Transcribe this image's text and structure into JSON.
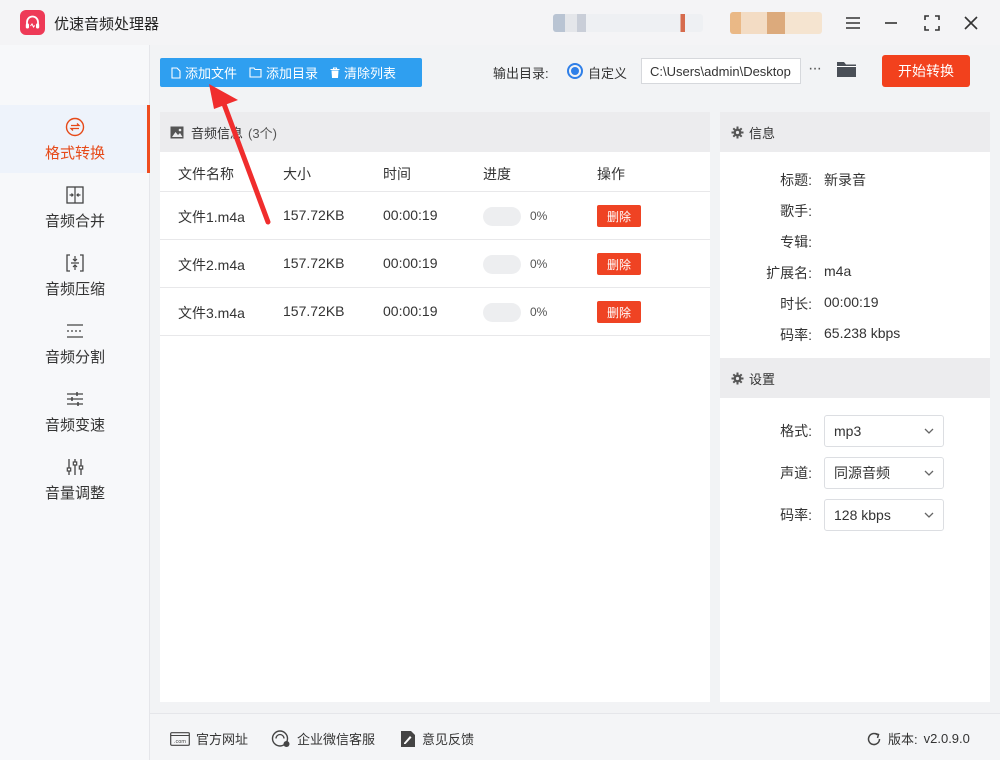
{
  "app": {
    "title": "优速音频处理器"
  },
  "sidebar": {
    "items": [
      {
        "label": "格式转换",
        "icon": "format-convert-icon",
        "active": true
      },
      {
        "label": "音频合并",
        "icon": "merge-icon",
        "active": false
      },
      {
        "label": "音频压缩",
        "icon": "compress-icon",
        "active": false
      },
      {
        "label": "音频分割",
        "icon": "split-icon",
        "active": false
      },
      {
        "label": "音频变速",
        "icon": "speed-icon",
        "active": false
      },
      {
        "label": "音量调整",
        "icon": "volume-icon",
        "active": false
      }
    ]
  },
  "toolbar": {
    "add_file": "添加文件",
    "add_dir": "添加目录",
    "clear_list": "清除列表",
    "output_label": "输出目录:",
    "output_option": "自定义",
    "output_path": "C:\\Users\\admin\\Desktop",
    "more": "···",
    "start": "开始转换"
  },
  "file_panel": {
    "title": "音频信息",
    "count": "(3个)",
    "columns": [
      "文件名称",
      "大小",
      "时间",
      "进度",
      "操作"
    ],
    "rows": [
      {
        "name": "文件1.m4a",
        "size": "157.72KB",
        "time": "00:00:19",
        "progress": "0%",
        "action": "删除"
      },
      {
        "name": "文件2.m4a",
        "size": "157.72KB",
        "time": "00:00:19",
        "progress": "0%",
        "action": "删除"
      },
      {
        "name": "文件3.m4a",
        "size": "157.72KB",
        "time": "00:00:19",
        "progress": "0%",
        "action": "删除"
      }
    ]
  },
  "info": {
    "header": "信息",
    "fields": [
      {
        "key": "标题:",
        "value": "新录音"
      },
      {
        "key": "歌手:",
        "value": ""
      },
      {
        "key": "专辑:",
        "value": ""
      },
      {
        "key": "扩展名:",
        "value": "m4a"
      },
      {
        "key": "时长:",
        "value": "00:00:19"
      },
      {
        "key": "码率:",
        "value": "65.238 kbps"
      }
    ]
  },
  "settings": {
    "header": "设置",
    "fields": [
      {
        "key": "格式:",
        "value": "mp3"
      },
      {
        "key": "声道:",
        "value": "同源音频"
      },
      {
        "key": "码率:",
        "value": "128 kbps"
      }
    ]
  },
  "footer": {
    "website": "官方网址",
    "wechat": "企业微信客服",
    "feedback": "意见反馈",
    "version_label": "版本:",
    "version": "v2.0.9.0"
  },
  "colors": {
    "accent": "#ef4c1f",
    "primary_blue": "#2f9ff0",
    "delete_red": "#ef4323",
    "logo_pink": "#ee3a57"
  }
}
